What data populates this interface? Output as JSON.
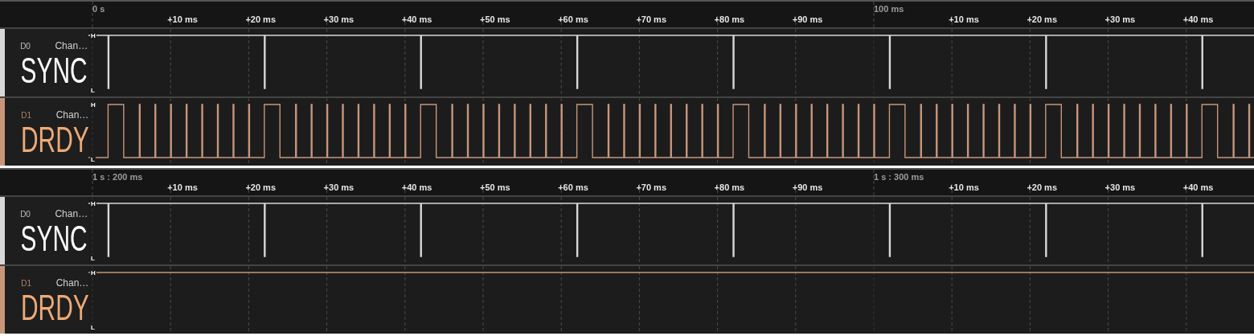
{
  "panels": [
    {
      "ruler": {
        "ticks": [
          {
            "kind": "major",
            "label": "0 s"
          },
          {
            "kind": "minor",
            "label": "+10 ms"
          },
          {
            "kind": "minor",
            "label": "+20 ms"
          },
          {
            "kind": "minor",
            "label": "+30 ms"
          },
          {
            "kind": "minor",
            "label": "+40 ms"
          },
          {
            "kind": "minor",
            "label": "+50 ms"
          },
          {
            "kind": "minor",
            "label": "+60 ms"
          },
          {
            "kind": "minor",
            "label": "+70 ms"
          },
          {
            "kind": "minor",
            "label": "+80 ms"
          },
          {
            "kind": "minor",
            "label": "+90 ms"
          },
          {
            "kind": "major",
            "label": "100 ms"
          },
          {
            "kind": "minor",
            "label": "+10 ms"
          },
          {
            "kind": "minor",
            "label": "+20 ms"
          },
          {
            "kind": "minor",
            "label": "+30 ms"
          },
          {
            "kind": "minor",
            "label": "+40 ms"
          }
        ]
      },
      "channels": [
        {
          "id": "D0",
          "name": "Chan…",
          "label": "SYNC",
          "color": "#d8d8d8",
          "kind": "sync",
          "high_marker": "H",
          "low_marker": "L"
        },
        {
          "id": "D1",
          "name": "Chan…",
          "label": "DRDY",
          "color": "#c8967a",
          "kind": "burst",
          "high_marker": "H",
          "low_marker": "L"
        }
      ]
    },
    {
      "ruler": {
        "ticks": [
          {
            "kind": "major",
            "label": "1 s : 200 ms"
          },
          {
            "kind": "minor",
            "label": "+10 ms"
          },
          {
            "kind": "minor",
            "label": "+20 ms"
          },
          {
            "kind": "minor",
            "label": "+30 ms"
          },
          {
            "kind": "minor",
            "label": "+40 ms"
          },
          {
            "kind": "minor",
            "label": "+50 ms"
          },
          {
            "kind": "minor",
            "label": "+60 ms"
          },
          {
            "kind": "minor",
            "label": "+70 ms"
          },
          {
            "kind": "minor",
            "label": "+80 ms"
          },
          {
            "kind": "minor",
            "label": "+90 ms"
          },
          {
            "kind": "major",
            "label": "1 s : 300 ms"
          },
          {
            "kind": "minor",
            "label": "+10 ms"
          },
          {
            "kind": "minor",
            "label": "+20 ms"
          },
          {
            "kind": "minor",
            "label": "+30 ms"
          },
          {
            "kind": "minor",
            "label": "+40 ms"
          }
        ]
      },
      "channels": [
        {
          "id": "D0",
          "name": "Chan…",
          "label": "SYNC",
          "color": "#d8d8d8",
          "kind": "sync",
          "high_marker": "H",
          "low_marker": "L"
        },
        {
          "id": "D1",
          "name": "Chan…",
          "label": "DRDY",
          "color": "#c8967a",
          "kind": "high",
          "high_marker": "H",
          "low_marker": "L"
        }
      ]
    }
  ]
}
